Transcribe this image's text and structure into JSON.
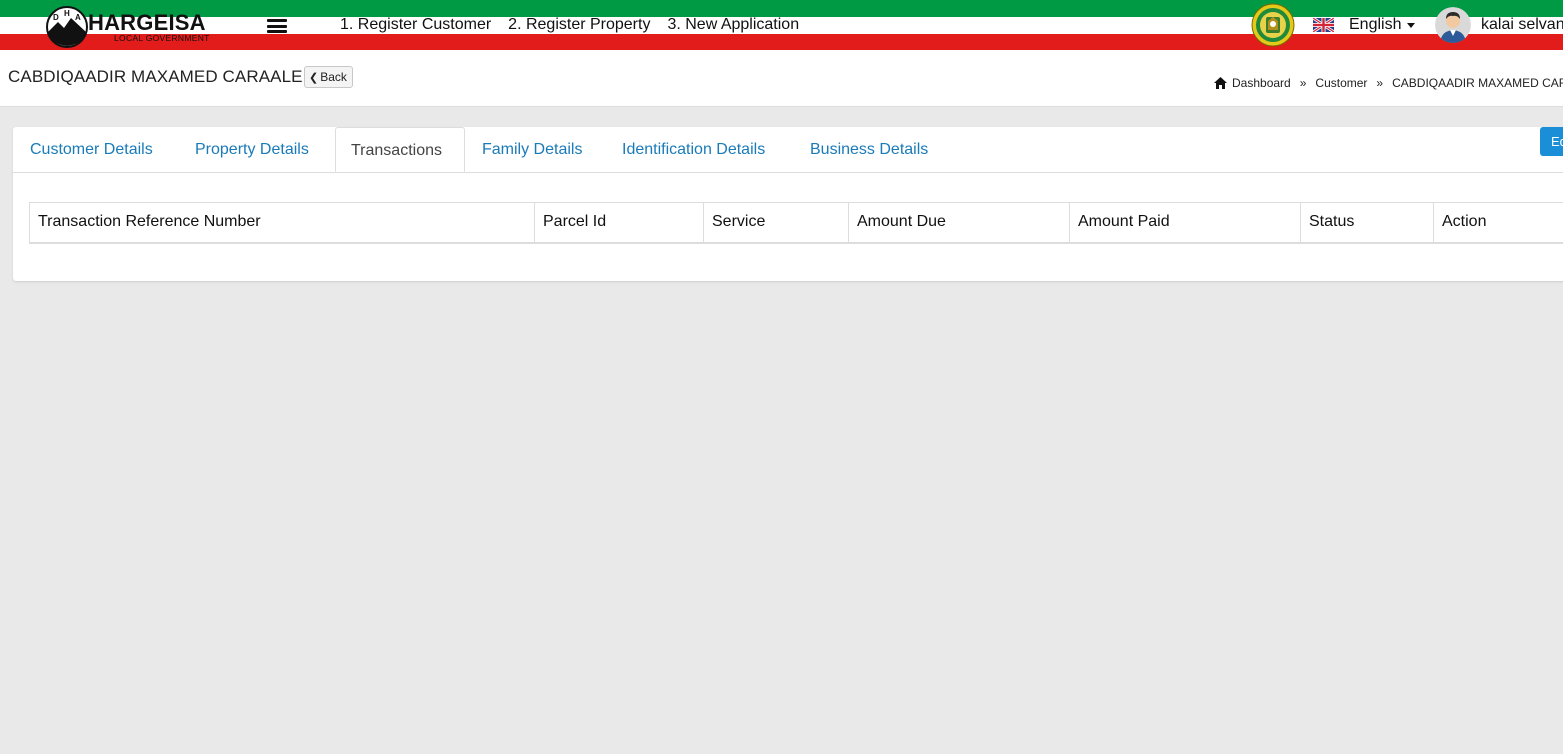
{
  "header": {
    "logo_title": "HARGEISA",
    "logo_subtitle": "LOCAL GOVERNMENT",
    "logo_letters": [
      "D",
      "H",
      "A"
    ],
    "nav": [
      {
        "label": "1. Register Customer"
      },
      {
        "label": "2. Register Property"
      },
      {
        "label": "3. New Application"
      }
    ],
    "language": "English",
    "user_name": "kalai selvan"
  },
  "page": {
    "title": "CABDIQAADIR MAXAMED CARAALE",
    "back_label": "Back",
    "breadcrumb": [
      {
        "label": "Dashboard"
      },
      {
        "label": "Customer"
      },
      {
        "label": "CABDIQAADIR MAXAMED CARAALE"
      }
    ]
  },
  "tabs": [
    {
      "label": "Customer Details",
      "active": false
    },
    {
      "label": "Property Details",
      "active": false
    },
    {
      "label": "Transactions",
      "active": true
    },
    {
      "label": "Family Details",
      "active": false
    },
    {
      "label": "Identification Details",
      "active": false
    },
    {
      "label": "Business Details",
      "active": false
    }
  ],
  "edit_label": "Edit",
  "table": {
    "columns": [
      "Transaction Reference Number",
      "Parcel Id",
      "Service",
      "Amount Due",
      "Amount Paid",
      "Status",
      "Action"
    ],
    "rows": []
  },
  "colors": {
    "flag_green": "#009a44",
    "flag_red": "#e21b1b",
    "link_blue": "#1a7bb9",
    "button_blue": "#1a8fd8",
    "page_background": "#e9e9e9"
  },
  "icons": [
    "hamburger-menu-icon",
    "government-emblem-icon",
    "uk-flag-icon",
    "user-avatar-icon",
    "home-icon",
    "chevron-left-icon",
    "caret-down-icon"
  ]
}
